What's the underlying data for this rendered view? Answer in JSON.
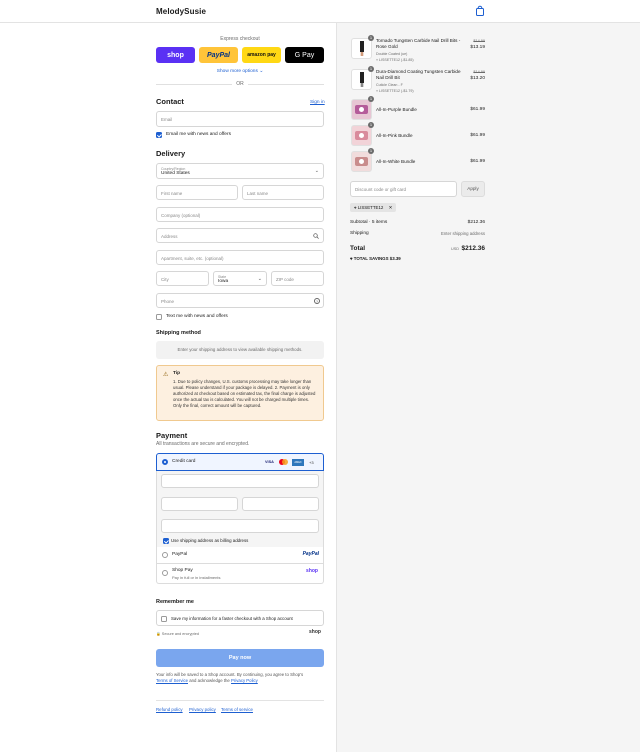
{
  "header": {
    "brand": "MelodySusie"
  },
  "express": {
    "label": "Express checkout",
    "buttons": [
      {
        "label": "shop",
        "color": "#5a31f4",
        "text_color": "#ffffff"
      },
      {
        "label": "PayPal",
        "color": "#ffc439",
        "text_color": "#003087"
      },
      {
        "label": "amazon pay",
        "color": "#ffd814",
        "text_color": "#111111"
      },
      {
        "label": "G Pay",
        "color": "#000000",
        "text_color": "#ffffff"
      }
    ],
    "more": "Show more options",
    "or": "OR"
  },
  "contact": {
    "title": "Contact",
    "sign_in": "Sign in",
    "email_placeholder": "Email",
    "news_label": "Email me with news and offers",
    "news_checked": true
  },
  "delivery": {
    "title": "Delivery",
    "country_label": "Country/Region",
    "country_value": "United States",
    "first_name": "First name",
    "last_name": "Last name",
    "company": "Company (optional)",
    "address": "Address",
    "apartment": "Apartment, suite, etc. (optional)",
    "city": "City",
    "state_label": "State",
    "state_value": "Iowa",
    "zip": "ZIP code",
    "phone": "Phone",
    "text_label": "Text me with news and offers"
  },
  "shipping": {
    "title": "Shipping method",
    "placeholder": "Enter your shipping address to view available shipping methods."
  },
  "tip": {
    "title": "Tip",
    "body": "1. Due to policy changes, U.S. customs processing may take longer than usual. Please understand if your package is delayed. 2. Payment is only authorized at checkout based on estimated tax, the final charge is adjusted once the actual tax is calculated. You will not be charged multiple times. Only the final, correct amount will be captured."
  },
  "payment": {
    "title": "Payment",
    "subtitle": "All transactions are secure and encrypted.",
    "credit_card": "Credit card",
    "card_brands": [
      "VISA",
      "MC",
      "AMEX"
    ],
    "more_cards": "+3",
    "billing_label": "Use shipping address as billing address",
    "paypal": "PayPal",
    "paypal_logo": "PayPal",
    "shop_pay": "Shop Pay",
    "shop_pay_sub": "Pay in full or in installments",
    "shop_logo": "shop"
  },
  "remember": {
    "title": "Remember me",
    "save_label": "Save my information for a faster checkout with a Shop account",
    "secure": "Secure and encrypted",
    "shop_logo": "shop"
  },
  "pay_button": "Pay now",
  "legal": {
    "line1": "Your info will be saved to a Shop account. By continuing, you agree to Shop's",
    "terms": "Terms of Service",
    "and": "and acknowledge the",
    "privacy": "Privacy Policy"
  },
  "footer_links": [
    "Refund policy",
    "Privacy policy",
    "Terms of service"
  ],
  "summary": {
    "items": [
      {
        "qty": "1",
        "name": "Tornado Tungsten Carbide Nail Drill Bits - Rose Gold",
        "variant": "Double Coated (ue)",
        "discount": "LISSETTE12 (-$1.85)",
        "old_price": "$14.99",
        "price": "$13.19"
      },
      {
        "qty": "1",
        "name": "Dura-Diamond Coating Tungsten Carbide Nail Drill Bit",
        "variant": "Cuticle Clean - F",
        "discount": "LISSETTE12 (-$1.79)",
        "old_price": "$14.99",
        "price": "$13.20"
      },
      {
        "qty": "1",
        "name": "All-In-Purple Bundle",
        "price": "$61.99"
      },
      {
        "qty": "1",
        "name": "All-In-Pink Bundle",
        "price": "$61.99"
      },
      {
        "qty": "1",
        "name": "All-In-White Bundle",
        "price": "$61.99"
      }
    ],
    "discount_placeholder": "Discount code or gift card",
    "apply": "Apply",
    "code_chip": "LISSETTE12",
    "subtotal_label": "Subtotal · 5 items",
    "subtotal_value": "$212.36",
    "shipping_label": "Shipping",
    "shipping_value": "Enter shipping address",
    "total_label": "Total",
    "currency": "USD",
    "total_value": "$212.36",
    "savings_label": "TOTAL SAVINGS",
    "savings_value": "$3.39"
  }
}
